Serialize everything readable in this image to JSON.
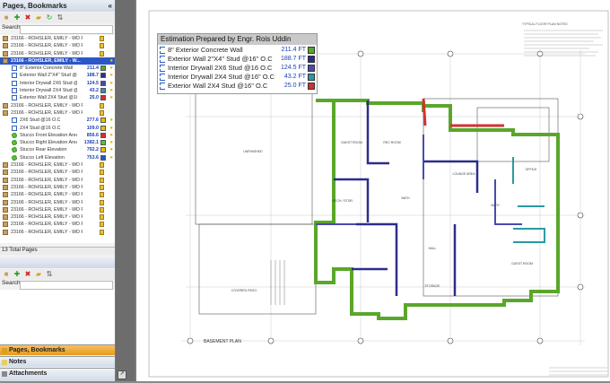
{
  "sidebar": {
    "title": "Pages, Bookmarks",
    "collapse": "«",
    "search_label": "Search:",
    "pages": [
      {
        "label": "23166 - ROHSLER, EMILY - WD FINAL - 2023..."
      },
      {
        "label": "23166 - ROHSLER, EMILY - WD FINAL - 2023..."
      },
      {
        "label": "23166 - ROHSLER, EMILY - WD FINAL - 2023..."
      },
      {
        "label": "23166 - ROHSLER, EMILY - W..."
      }
    ],
    "measurements": [
      {
        "label": "8\" Exterior Concrete Wall",
        "value": "211.4",
        "color": "#5aa62a"
      },
      {
        "label": "Exterior Wall 2\"X4\" Stud @...",
        "value": "188.7",
        "color": "#2d2d8a"
      },
      {
        "label": "Interior Drywall 2X6 Stud @...",
        "value": "124.5",
        "color": "#4a4ab0"
      },
      {
        "label": "Interior Drywall 2X4 Stud @...",
        "value": "43.2",
        "color": "#2a9aa0"
      },
      {
        "label": "Exterior Wall 2X4 Stud @16...",
        "value": "25.0",
        "color": "#d43030"
      }
    ],
    "pages_mid": [
      {
        "label": "23166 - ROHSLER, EMILY - WD FINAL - 2023..."
      },
      {
        "label": "23166 - ROHSLER, EMILY - WD FINAL - 2023..."
      }
    ],
    "studs": [
      {
        "label": "2X6 Stud @16 O.C",
        "value": "277.6",
        "color": "#e8c000"
      },
      {
        "label": "2X4 Stud @16 O.C",
        "value": "109.0",
        "color": "#e8c000"
      }
    ],
    "stucco": [
      {
        "label": "Stucco Front Elevation Area",
        "value": "856.6",
        "color": "#d43030"
      },
      {
        "label": "Stucco Right Elevation Area",
        "value": "1382.1",
        "color": "#5bbf3a"
      },
      {
        "label": "Stucco Rear Elevation",
        "value": "792.2",
        "color": "#e8c000"
      },
      {
        "label": "Stucco Left Elevation",
        "value": "753.6",
        "color": "#2c57c8"
      }
    ],
    "pages_end": [
      {
        "label": "23166 - ROHSLER, EMILY - WD FINAL - 2023..."
      },
      {
        "label": "23166 - ROHSLER, EMILY - WD FINAL - 2023..."
      },
      {
        "label": "23166 - ROHSLER, EMILY - WD FINAL - 2023..."
      },
      {
        "label": "23166 - ROHSLER, EMILY - WD FINAL - 2023..."
      },
      {
        "label": "23166 - ROHSLER, EMILY - WD FINAL - 2023..."
      },
      {
        "label": "23166 - ROHSLER, EMILY - WD FINAL - 2023..."
      },
      {
        "label": "23166 - ROHSLER, EMILY - WD FINAL - 2023..."
      },
      {
        "label": "23166 - ROHSLER, EMILY - WD FINAL - 2023..."
      },
      {
        "label": "23166 - ROHSLER, EMILY - WD FINAL - 2023..."
      },
      {
        "label": "23166 - ROHSLER, EMILY - WD FINAL - 2023..."
      }
    ],
    "total_pages": "13 Total Pages",
    "tabs": [
      "Pages, Bookmarks",
      "Notes",
      "Attachments"
    ]
  },
  "legend": {
    "title": "Estimation Prepared by Engr. Rois Uddin",
    "items": [
      {
        "label": "8\" Exterior Concrete Wall",
        "value": "211.4 FT",
        "color": "#5aa62a"
      },
      {
        "label": "Exterior Wall 2\"X4\" Stud @16\" O.C",
        "value": "188.7 FT",
        "color": "#2d2d8a"
      },
      {
        "label": "Interior Drywall 2X6 Stud @16 O.C",
        "value": "124.5 FT",
        "color": "#4a4ab0"
      },
      {
        "label": "Interior Drywall 2X4 Stud @16\" O.C",
        "value": "43.2 FT",
        "color": "#2a9aa0"
      },
      {
        "label": "Exterior Wall 2X4 Stud @16\" O.C",
        "value": "25.0 FT",
        "color": "#d43030"
      }
    ]
  },
  "plan": {
    "title": "BASEMENT PLAN",
    "rooms": [
      "UNFINISHED",
      "GUEST ROOM",
      "REC ROOM",
      "LOUNGE AREA",
      "OFFICE",
      "MECH / STOR.",
      "BATH",
      "HALL",
      "BATH",
      "GUEST ROOM",
      "STORAGE",
      "COVERED PATIO"
    ],
    "notes_title": "TYPICAL FLOOR PLAN NOTES"
  }
}
